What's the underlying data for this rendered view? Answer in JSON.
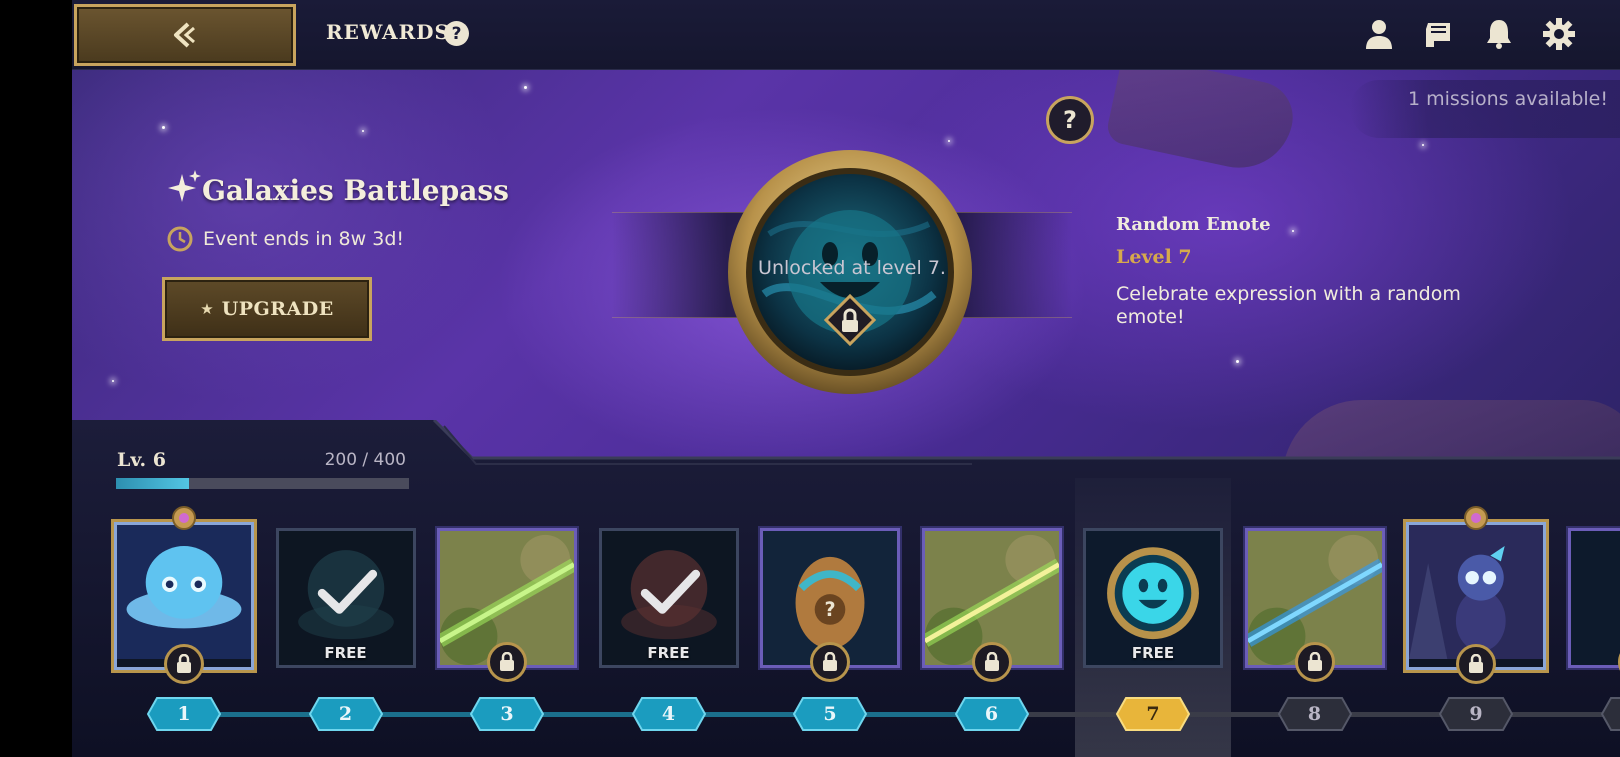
{
  "header": {
    "title": "REWARDS",
    "help_glyph": "?",
    "icons": [
      "back-arrow-icon",
      "profile-icon",
      "scroll-icon",
      "bell-icon",
      "gear-icon"
    ]
  },
  "hero": {
    "missions": "1 missions available!",
    "battlepass_title": "Galaxies Battlepass",
    "event_ends": "Event ends in 8w 3d!",
    "upgrade_label": "UPGRADE",
    "help_glyph": "?",
    "unlock_text": "Unlocked at level 7.",
    "reward_name": "Random Emote",
    "reward_level": "Level 7",
    "reward_desc": "Celebrate expression with a random emote!"
  },
  "progress": {
    "level_label": "Lv. 6",
    "xp_text": "200 / 400",
    "fraction": 0.5
  },
  "track": {
    "rewards": [
      {
        "level": "1",
        "type": "premium-featured",
        "label": "",
        "locked": true,
        "art": "little-legend"
      },
      {
        "level": "2",
        "type": "free",
        "label": "FREE",
        "locked": false,
        "claimed": true,
        "art": "little-legend-faded"
      },
      {
        "level": "3",
        "type": "premium",
        "label": "",
        "locked": true,
        "art": "arena-boom-green"
      },
      {
        "level": "4",
        "type": "free",
        "label": "FREE",
        "locked": false,
        "claimed": true,
        "art": "little-legend-faded-red"
      },
      {
        "level": "5",
        "type": "premium",
        "label": "",
        "locked": true,
        "art": "mystery-egg"
      },
      {
        "level": "6",
        "type": "premium",
        "label": "",
        "locked": true,
        "art": "arena-boom-yellow"
      },
      {
        "level": "7",
        "type": "free",
        "label": "FREE",
        "locked": false,
        "claimed": false,
        "art": "emote"
      },
      {
        "level": "8",
        "type": "premium",
        "label": "",
        "locked": true,
        "art": "arena-boom-blue"
      },
      {
        "level": "9",
        "type": "premium-featured",
        "label": "",
        "locked": true,
        "art": "little-legend-robot"
      },
      {
        "level": "10",
        "type": "premium",
        "label": "",
        "locked": true,
        "art": "emote-partial"
      }
    ],
    "reached_level": 6,
    "selected_level": 7
  }
}
